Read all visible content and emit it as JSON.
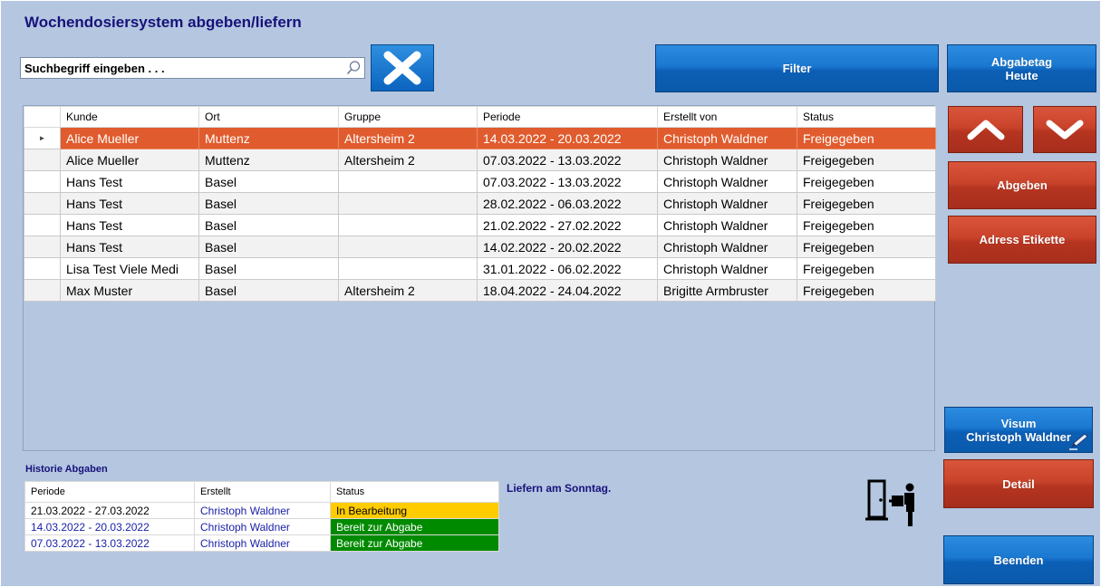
{
  "window": {
    "title": "Wochendosiersystem abgeben/liefern"
  },
  "search": {
    "placeholder": "Suchbegriff eingeben . . .",
    "value": ""
  },
  "buttons": {
    "filter": "Filter",
    "abgabetag_line1": "Abgabetag",
    "abgabetag_line2": "Heute",
    "abgeben": "Abgeben",
    "adress_etikette": "Adress Etikette",
    "visum_line1": "Visum",
    "visum_line2": "Christoph Waldner",
    "detail": "Detail",
    "beenden": "Beenden"
  },
  "grid": {
    "columns": [
      "Kunde",
      "Ort",
      "Gruppe",
      "Periode",
      "Erstellt von",
      "Status"
    ],
    "rows": [
      [
        "Alice Mueller",
        "Muttenz",
        "Altersheim 2",
        "14.03.2022 - 20.03.2022",
        "Christoph Waldner",
        "Freigegeben"
      ],
      [
        "Alice Mueller",
        "Muttenz",
        "Altersheim 2",
        "07.03.2022 - 13.03.2022",
        "Christoph Waldner",
        "Freigegeben"
      ],
      [
        "Hans Test",
        "Basel",
        "",
        "07.03.2022 - 13.03.2022",
        "Christoph Waldner",
        "Freigegeben"
      ],
      [
        "Hans Test",
        "Basel",
        "",
        "28.02.2022 - 06.03.2022",
        "Christoph Waldner",
        "Freigegeben"
      ],
      [
        "Hans Test",
        "Basel",
        "",
        "21.02.2022 - 27.02.2022",
        "Christoph Waldner",
        "Freigegeben"
      ],
      [
        "Hans Test",
        "Basel",
        "",
        "14.02.2022 - 20.02.2022",
        "Christoph Waldner",
        "Freigegeben"
      ],
      [
        "Lisa Test Viele Medi",
        "Basel",
        "",
        "31.01.2022 - 06.02.2022",
        "Christoph Waldner",
        "Freigegeben"
      ],
      [
        "Max Muster",
        "Basel",
        "Altersheim 2",
        "18.04.2022 - 24.04.2022",
        "Brigitte Armbruster",
        "Freigegeben"
      ]
    ],
    "selected_row": 0
  },
  "history": {
    "title": "Historie Abgaben",
    "columns": [
      "Periode",
      "Erstellt",
      "Status"
    ],
    "rows": [
      {
        "periode": "21.03.2022 - 27.03.2022",
        "erstellt": "Christoph Waldner",
        "status": "In Bearbeitung",
        "status_color": "#ffcc00",
        "status_text_color": "#000000",
        "periode_color": "#000000"
      },
      {
        "periode": "14.03.2022 - 20.03.2022",
        "erstellt": "Christoph Waldner",
        "status": "Bereit zur Abgabe",
        "status_color": "#008a00",
        "status_text_color": "#ffffff",
        "periode_color": "#1c22a8"
      },
      {
        "periode": "07.03.2022 - 13.03.2022",
        "erstellt": "Christoph Waldner",
        "status": "Bereit zur Abgabe",
        "status_color": "#008a00",
        "status_text_color": "#ffffff",
        "periode_color": "#1c22a8"
      }
    ]
  },
  "note": "Liefern am Sonntag.",
  "icons": {
    "search": "search-icon",
    "clear": "close-icon",
    "up": "chevron-up-icon",
    "down": "chevron-down-icon",
    "visum": "pen-icon",
    "deliver": "door-delivery-icon"
  },
  "colors": {
    "background": "#b4c6e0",
    "title": "#17127a",
    "selected_row": "#e05c2e",
    "button_blue": "#1a78d0",
    "button_red": "#c9432b"
  }
}
